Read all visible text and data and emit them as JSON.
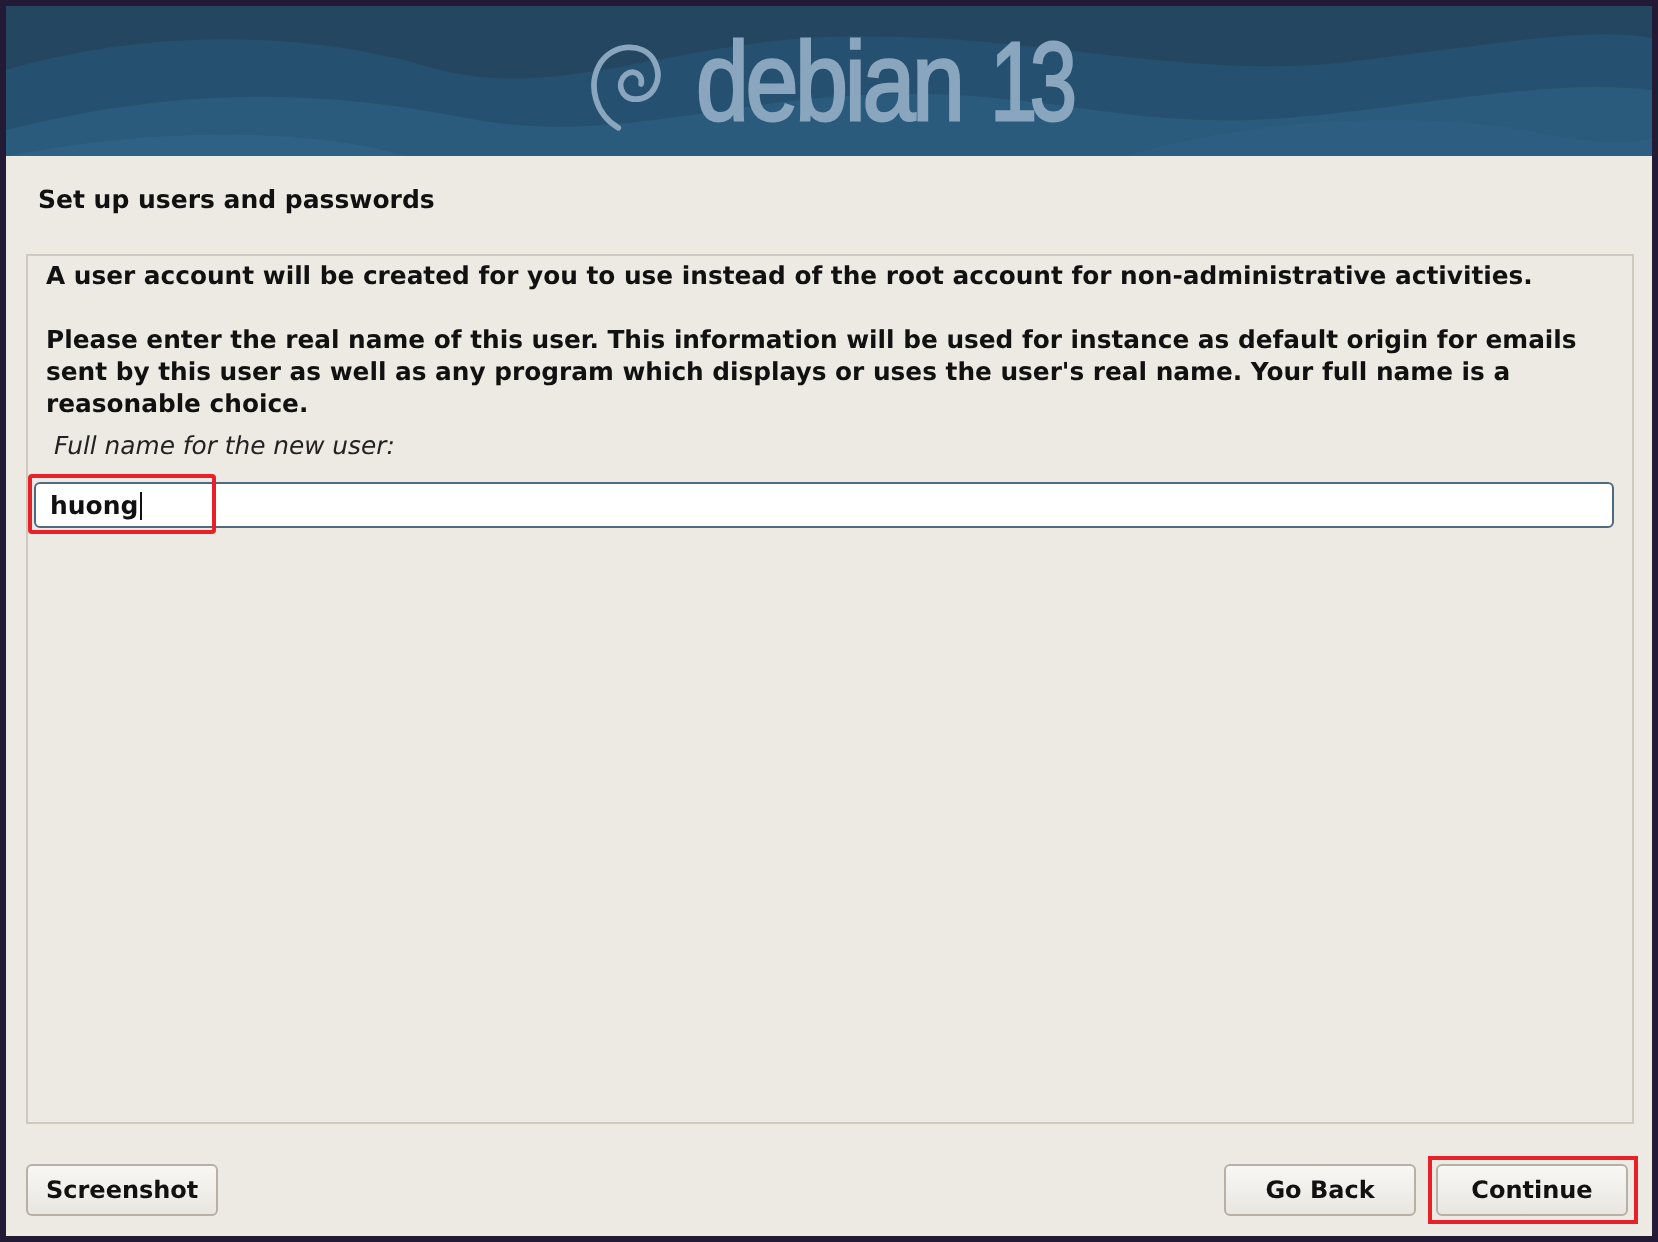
{
  "banner": {
    "logo_name": "debian",
    "logo_version": "13"
  },
  "title": "Set up users and passwords",
  "paragraphs": [
    "A user account will be created for you to use instead of the root account for non-administrative activities.",
    "Please enter the real name of this user. This information will be used for instance as default origin for emails sent by this user as well as any program which displays or uses the user's real name. Your full name is a reasonable choice."
  ],
  "field": {
    "label": "Full name for the new user:",
    "value": "huong",
    "focused": true,
    "highlighted": true
  },
  "buttons_left": [
    {
      "label": "Screenshot",
      "highlighted": false
    }
  ],
  "buttons_right": [
    {
      "label": "Go Back",
      "highlighted": false
    },
    {
      "label": "Continue",
      "highlighted": true
    }
  ]
}
